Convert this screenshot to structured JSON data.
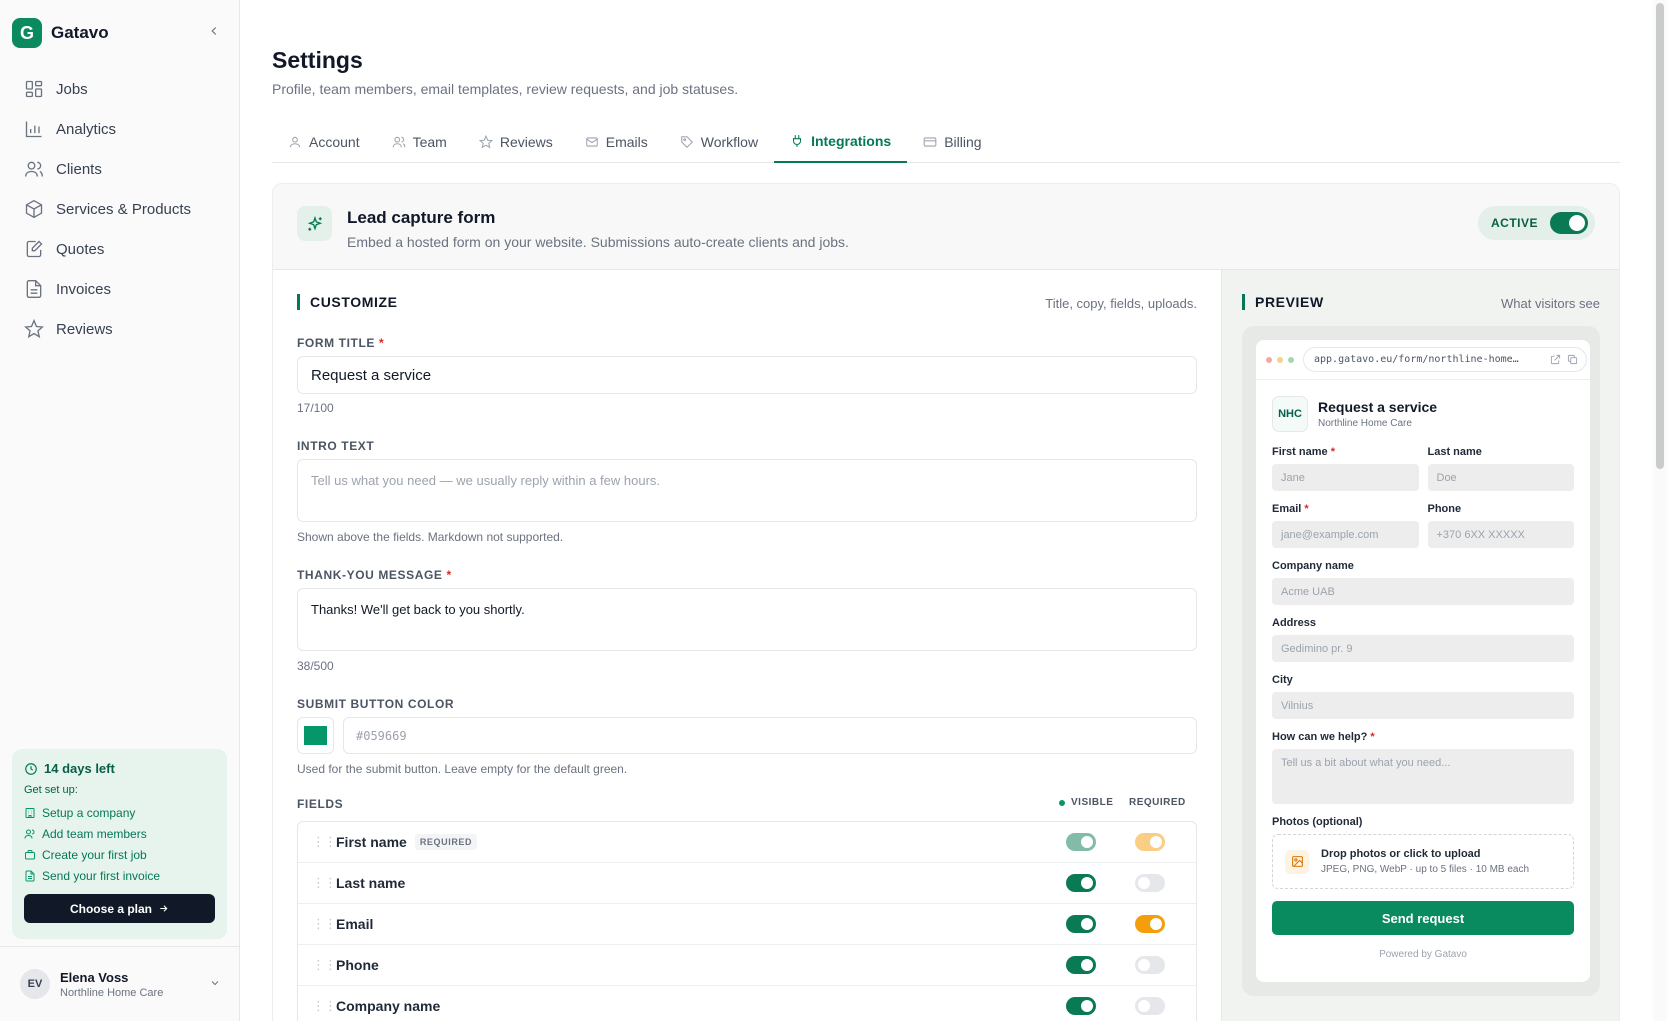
{
  "app": {
    "name": "Gatavo",
    "logo_letter": "G"
  },
  "sidebar": {
    "items": [
      {
        "label": "Jobs",
        "icon": "grid-icon"
      },
      {
        "label": "Analytics",
        "icon": "bar-chart-icon"
      },
      {
        "label": "Clients",
        "icon": "users-icon"
      },
      {
        "label": "Services & Products",
        "icon": "box-icon"
      },
      {
        "label": "Quotes",
        "icon": "edit-doc-icon"
      },
      {
        "label": "Invoices",
        "icon": "file-icon"
      },
      {
        "label": "Reviews",
        "icon": "star-icon"
      }
    ],
    "trial": {
      "days_left": "14 days left",
      "subtitle": "Get set up:",
      "steps": [
        "Setup a company",
        "Add team members",
        "Create your first job",
        "Send your first invoice"
      ],
      "plan_button": "Choose a plan"
    },
    "user": {
      "initials": "EV",
      "name": "Elena Voss",
      "org": "Northline Home Care"
    }
  },
  "page": {
    "title": "Settings",
    "subtitle": "Profile, team members, email templates, review requests, and job statuses.",
    "tabs": [
      {
        "label": "Account",
        "icon": "user-icon"
      },
      {
        "label": "Team",
        "icon": "users-icon"
      },
      {
        "label": "Reviews",
        "icon": "star-icon"
      },
      {
        "label": "Emails",
        "icon": "mail-icon"
      },
      {
        "label": "Workflow",
        "icon": "tag-icon"
      },
      {
        "label": "Integrations",
        "icon": "plug-icon",
        "active": true
      },
      {
        "label": "Billing",
        "icon": "card-icon"
      }
    ]
  },
  "lead_form": {
    "title": "Lead capture form",
    "description": "Embed a hosted form on your website. Submissions auto-create clients and jobs.",
    "status_label": "ACTIVE",
    "active": true
  },
  "customize": {
    "heading": "CUSTOMIZE",
    "hint": "Title, copy, fields, uploads.",
    "form_title_label": "FORM TITLE",
    "form_title_value": "Request a service",
    "form_title_count": "17/100",
    "intro_label": "INTRO TEXT",
    "intro_placeholder": "Tell us what you need — we usually reply within a few hours.",
    "intro_helper": "Shown above the fields. Markdown not supported.",
    "thanks_label": "THANK-YOU MESSAGE",
    "thanks_value": "Thanks! We'll get back to you shortly.",
    "thanks_count": "38/500",
    "color_label": "SUBMIT BUTTON COLOR",
    "color_placeholder": "#059669",
    "color_swatch": "#059669",
    "color_helper": "Used for the submit button. Leave empty for the default green.",
    "fields_label": "FIELDS",
    "col_visible": "VISIBLE",
    "col_required": "REQUIRED",
    "required_badge": "REQUIRED",
    "fields": [
      {
        "name": "First name",
        "locked": true,
        "visible": true,
        "required": true
      },
      {
        "name": "Last name",
        "visible": true,
        "required": false
      },
      {
        "name": "Email",
        "visible": true,
        "required": true
      },
      {
        "name": "Phone",
        "visible": true,
        "required": false
      },
      {
        "name": "Company name",
        "visible": true,
        "required": false
      }
    ]
  },
  "preview": {
    "heading": "PREVIEW",
    "hint": "What visitors see",
    "url": "app.gatavo.eu/form/northline-home…",
    "logo_text": "NHC",
    "form_title": "Request a service",
    "org": "Northline Home Care",
    "first_name_label": "First name",
    "first_name_ph": "Jane",
    "last_name_label": "Last name",
    "last_name_ph": "Doe",
    "email_label": "Email",
    "email_ph": "jane@example.com",
    "phone_label": "Phone",
    "phone_ph": "+370 6XX XXXXX",
    "company_label": "Company name",
    "company_ph": "Acme UAB",
    "address_label": "Address",
    "address_ph": "Gedimino pr. 9",
    "city_label": "City",
    "city_ph": "Vilnius",
    "help_label": "How can we help?",
    "help_ph": "Tell us a bit about what you need...",
    "photos_label": "Photos (optional)",
    "drop_title": "Drop photos or click to upload",
    "drop_sub": "JPEG, PNG, WebP · up to 5 files · 10 MB each",
    "submit": "Send request",
    "powered": "Powered by Gatavo"
  },
  "colors": {
    "accent": "#047857",
    "brand": "#0a8a5f",
    "warning": "#f59e0b"
  }
}
